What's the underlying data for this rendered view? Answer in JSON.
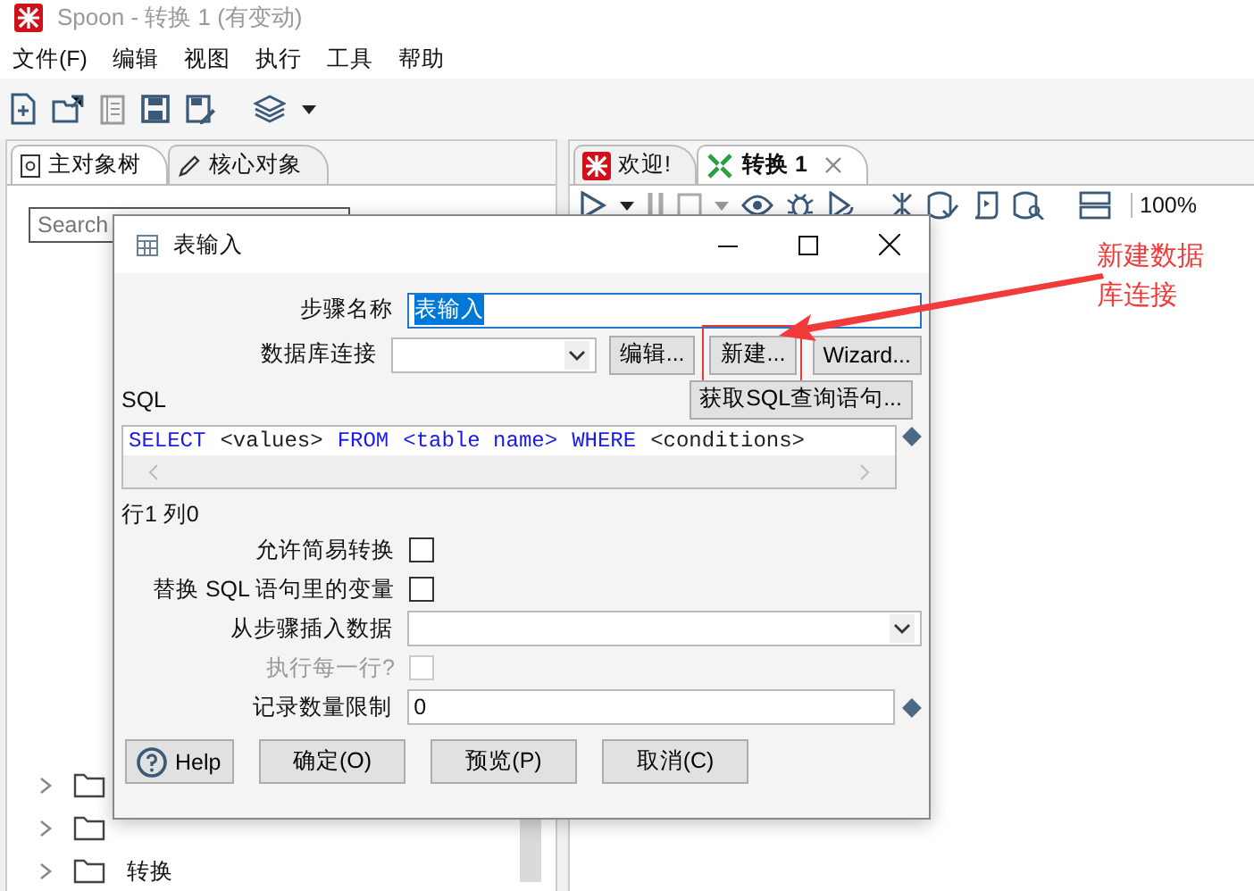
{
  "app": {
    "title": "Spoon - 转换 1 (有变动)",
    "menu": [
      "文件(F)",
      "编辑",
      "视图",
      "执行",
      "工具",
      "帮助"
    ]
  },
  "left_panel": {
    "tabs": [
      {
        "label": "主对象树",
        "selected": true
      },
      {
        "label": "核心对象",
        "selected": false
      }
    ],
    "search": {
      "placeholder": "Search"
    },
    "tree": [
      {
        "expanded": false
      },
      {
        "expanded": false
      },
      {
        "label": "转换",
        "expanded": false
      }
    ]
  },
  "right_panel": {
    "tabs": [
      {
        "label": "欢迎!",
        "selected": false,
        "closable": false
      },
      {
        "label": "转换 1",
        "selected": true,
        "closable": true
      }
    ],
    "zoom": "100%"
  },
  "dialog": {
    "title": "表输入",
    "step_name": {
      "label": "步骤名称",
      "value": "表输入",
      "text_selected": true
    },
    "connection": {
      "label": "数据库连接",
      "buttons": [
        {
          "label": "编辑...",
          "highlighted": false
        },
        {
          "label": "新建...",
          "highlighted": true
        },
        {
          "label": "Wizard...",
          "highlighted": false
        }
      ]
    },
    "sql_label": "SQL",
    "get_sql_button": "获取SQL查询语句...",
    "sql": [
      {
        "text": "SELECT",
        "kind": "keyword"
      },
      {
        "text": "<values>",
        "kind": "plain"
      },
      {
        "text": "FROM",
        "kind": "keyword"
      },
      {
        "text": "<table name>",
        "kind": "keyword"
      },
      {
        "text": "WHERE",
        "kind": "keyword"
      },
      {
        "text": "<conditions>",
        "kind": "plain"
      }
    ],
    "position": "行1 列0",
    "options": [
      {
        "kind": "checkbox",
        "label": "允许简易转换",
        "checked": false,
        "disabled": false
      },
      {
        "kind": "checkbox",
        "label": "替换 SQL 语句里的变量",
        "checked": false,
        "disabled": false
      },
      {
        "kind": "dropdown",
        "label": "从步骤插入数据"
      },
      {
        "kind": "checkbox",
        "label": "执行每一行?",
        "checked": false,
        "disabled": true
      },
      {
        "kind": "text",
        "label": "记录数量限制",
        "value": "0"
      }
    ],
    "help": "Help",
    "buttons": [
      "确定(O)",
      "预览(P)",
      "取消(C)"
    ]
  },
  "annotation": {
    "text": "新建数据库连接"
  }
}
